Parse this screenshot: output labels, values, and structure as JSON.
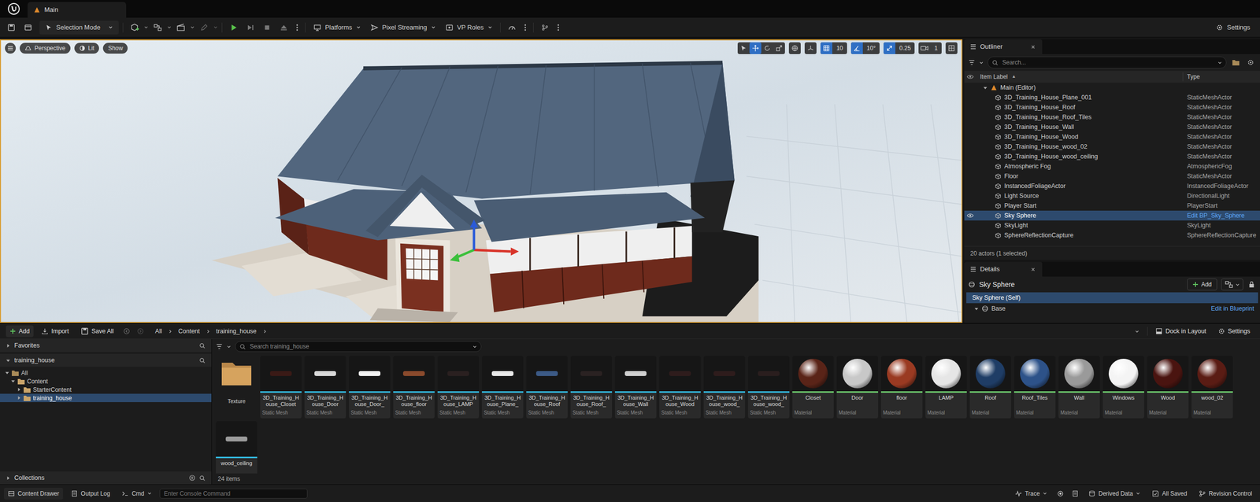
{
  "window": {
    "title": "Main"
  },
  "toolbar": {
    "mode": "Selection Mode",
    "menus": [
      "Platforms",
      "Pixel Streaming",
      "VP Roles"
    ],
    "settings": "Settings"
  },
  "viewport": {
    "view": "Perspective",
    "lighting": "Lit",
    "show": "Show",
    "snaps": [
      {
        "value": "10",
        "on": true
      },
      {
        "value": "10°",
        "on": true
      },
      {
        "value": "0.25",
        "on": true
      },
      {
        "value": "1",
        "on": false
      }
    ]
  },
  "outliner": {
    "title": "Outliner",
    "search": {
      "placeholder": "Search..."
    },
    "columns": [
      {
        "label": "Item Label",
        "sort": "▲"
      },
      {
        "label": "Type"
      }
    ],
    "root": "Main (Editor)",
    "rows": [
      {
        "label": "3D_Training_House_Plane_001",
        "type": "StaticMeshActor",
        "selected": false,
        "link": false,
        "eye": false
      },
      {
        "label": "3D_Training_House_Roof",
        "type": "StaticMeshActor",
        "selected": false,
        "link": false,
        "eye": false
      },
      {
        "label": "3D_Training_House_Roof_Tiles",
        "type": "StaticMeshActor",
        "selected": false,
        "link": false,
        "eye": false
      },
      {
        "label": "3D_Training_House_Wall",
        "type": "StaticMeshActor",
        "selected": false,
        "link": false,
        "eye": false
      },
      {
        "label": "3D_Training_House_Wood",
        "type": "StaticMeshActor",
        "selected": false,
        "link": false,
        "eye": false
      },
      {
        "label": "3D_Training_House_wood_02",
        "type": "StaticMeshActor",
        "selected": false,
        "link": false,
        "eye": false
      },
      {
        "label": "3D_Training_House_wood_ceiling",
        "type": "StaticMeshActor",
        "selected": false,
        "link": false,
        "eye": false
      },
      {
        "label": "Atmospheric Fog",
        "type": "AtmosphericFog",
        "selected": false,
        "link": false,
        "eye": false
      },
      {
        "label": "Floor",
        "type": "StaticMeshActor",
        "selected": false,
        "link": false,
        "eye": false
      },
      {
        "label": "InstancedFoliageActor",
        "type": "InstancedFoliageActor",
        "selected": false,
        "link": false,
        "eye": false
      },
      {
        "label": "Light Source",
        "type": "DirectionalLight",
        "selected": false,
        "link": false,
        "eye": false
      },
      {
        "label": "Player Start",
        "type": "PlayerStart",
        "selected": false,
        "link": false,
        "eye": false
      },
      {
        "label": "Sky Sphere",
        "type": "Edit BP_Sky_Sphere",
        "selected": true,
        "link": true,
        "eye": true
      },
      {
        "label": "SkyLight",
        "type": "SkyLight",
        "selected": false,
        "link": false,
        "eye": false
      },
      {
        "label": "SphereReflectionCapture",
        "type": "SphereReflectionCapture",
        "selected": false,
        "link": false,
        "eye": false
      }
    ],
    "footer": "20 actors (1 selected)"
  },
  "details": {
    "title": "Details",
    "object": "Sky Sphere",
    "add": "Add",
    "components": [
      {
        "label": "Sky Sphere (Self)",
        "selected": true
      },
      {
        "label": "Base",
        "selected": false
      }
    ],
    "edit_link": "Edit in Blueprint"
  },
  "content_browser": {
    "buttons": [
      "Add",
      "Import",
      "Save All"
    ],
    "breadcrumb": [
      "All",
      "Content",
      "training_house"
    ],
    "dock": "Dock in Layout",
    "settings": "Settings",
    "favorites": "Favorites",
    "source": "training_house",
    "tree": [
      {
        "label": "All",
        "depth": 0,
        "expanded": true,
        "selected": false
      },
      {
        "label": "Content",
        "depth": 1,
        "expanded": true,
        "selected": false
      },
      {
        "label": "StarterContent",
        "depth": 2,
        "expanded": false,
        "selected": false
      },
      {
        "label": "training_house",
        "depth": 2,
        "expanded": false,
        "selected": true
      }
    ],
    "collections": "Collections",
    "search": {
      "placeholder": "Search training_house"
    },
    "items": [
      {
        "name": "Texture",
        "kind": "folder",
        "color": "#c9a46a"
      },
      {
        "name": "3D_Training_House_Closet",
        "type": "Static Mesh",
        "kind": "mesh",
        "color": "#3a1a16"
      },
      {
        "name": "3D_Training_House_Door",
        "type": "Static Mesh",
        "kind": "mesh",
        "color": "#d8d8d8"
      },
      {
        "name": "3D_Training_House_Door_",
        "type": "Static Mesh",
        "kind": "mesh",
        "color": "#f2f2f2"
      },
      {
        "name": "3D_Training_House_floor",
        "type": "Static Mesh",
        "kind": "mesh",
        "color": "#8a4a2c"
      },
      {
        "name": "3D_Training_House_LAMP",
        "type": "Static Mesh",
        "kind": "mesh",
        "color": "#2a2020"
      },
      {
        "name": "3D_Training_House_Plane_",
        "type": "Static Mesh",
        "kind": "mesh",
        "color": "#e8e8e8"
      },
      {
        "name": "3D_Training_House_Roof",
        "type": "Static Mesh",
        "kind": "mesh",
        "color": "#3c5a86"
      },
      {
        "name": "3D_Training_House_Roof_",
        "type": "Static Mesh",
        "kind": "mesh",
        "color": "#2a2222"
      },
      {
        "name": "3D_Training_House_Wall",
        "type": "Static Mesh",
        "kind": "mesh",
        "color": "#cfcfcf"
      },
      {
        "name": "3D_Training_House_Wood",
        "type": "Static Mesh",
        "kind": "mesh",
        "color": "#2e1c1c"
      },
      {
        "name": "3D_Training_House_wood_",
        "type": "Static Mesh",
        "kind": "mesh",
        "color": "#2e1c1c"
      },
      {
        "name": "3D_Training_House_wood_",
        "type": "Static Mesh",
        "kind": "mesh",
        "color": "#2a1e1e"
      },
      {
        "name": "Closet",
        "type": "Material",
        "kind": "material",
        "color": "#5a2418"
      },
      {
        "name": "Door",
        "type": "Material",
        "kind": "material",
        "color": "#c8c8c8"
      },
      {
        "name": "floor",
        "type": "Material",
        "kind": "material",
        "color": "#9a3a22"
      },
      {
        "name": "LAMP",
        "type": "Material",
        "kind": "material",
        "color": "#e6e6e6"
      },
      {
        "name": "Roof",
        "type": "Material",
        "kind": "material",
        "color": "#1f3d66"
      },
      {
        "name": "Roof_Tiles",
        "type": "Material",
        "kind": "material",
        "color": "#2d5289"
      },
      {
        "name": "Wall",
        "type": "Material",
        "kind": "material",
        "color": "#9a9a9a"
      },
      {
        "name": "Windows",
        "type": "Material",
        "kind": "material",
        "color": "#f4f4f4"
      },
      {
        "name": "Wood",
        "type": "Material",
        "kind": "material",
        "color": "#4a1410"
      },
      {
        "name": "wood_02",
        "type": "Material",
        "kind": "material",
        "color": "#5a1c14"
      },
      {
        "name": "wood_ceiling",
        "kind": "mesh",
        "color": "#9a9a9a"
      }
    ],
    "count": "24 items"
  },
  "status_bar": {
    "left": [
      "Content Drawer",
      "Output Log",
      "Cmd"
    ],
    "console_placeholder": "Enter Console Command",
    "right": [
      "Trace",
      "Derived Data",
      "All Saved",
      "Revision Control"
    ]
  }
}
